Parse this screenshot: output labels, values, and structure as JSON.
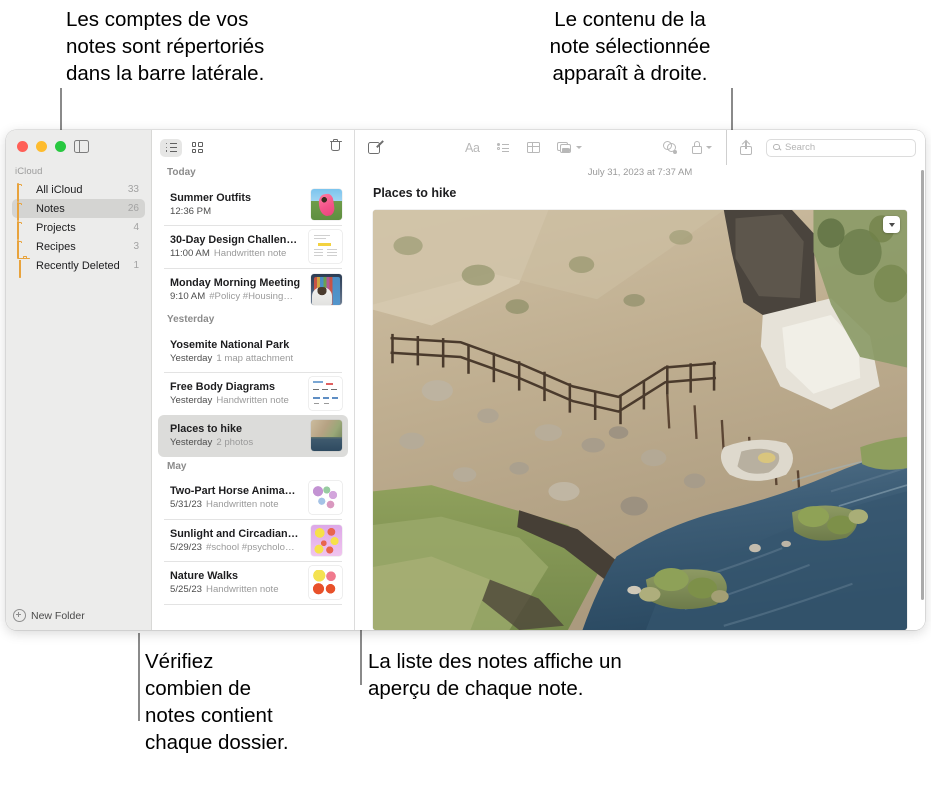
{
  "callouts": {
    "top_left": "Les comptes de vos\nnotes sont répertoriés\ndans la barre latérale.",
    "top_right": "Le contenu de la\nnote sélectionnée\napparaît à droite.",
    "bottom_left": "Vérifiez\ncombien de\nnotes contient\nchaque dossier.",
    "bottom_right": "La liste des notes affiche un\naperçu de chaque note."
  },
  "sidebar": {
    "section_label": "iCloud",
    "items": [
      {
        "label": "All iCloud",
        "count": "33",
        "icon": "folder-icon",
        "selected": false
      },
      {
        "label": "Notes",
        "count": "26",
        "icon": "folder-icon",
        "selected": true
      },
      {
        "label": "Projects",
        "count": "4",
        "icon": "folder-icon",
        "selected": false
      },
      {
        "label": "Recipes",
        "count": "3",
        "icon": "folder-icon",
        "selected": false
      },
      {
        "label": "Recently Deleted",
        "count": "1",
        "icon": "trash-icon",
        "selected": false
      }
    ],
    "new_folder_label": "New Folder"
  },
  "notes_list": {
    "view_list_icon": "list-view-icon",
    "view_grid_icon": "grid-view-icon",
    "delete_icon": "trash-icon",
    "groups": [
      {
        "header": "Today",
        "notes": [
          {
            "title": "Summer Outfits",
            "date": "12:36 PM",
            "subtitle": "",
            "thumb": "th-summer",
            "framed": false,
            "selected": false
          },
          {
            "title": "30-Day Design Challen…",
            "date": "11:00 AM",
            "subtitle": "Handwritten note",
            "thumb": "th-doc",
            "framed": true,
            "selected": false
          },
          {
            "title": "Monday Morning Meeting",
            "date": "9:10 AM",
            "subtitle": "#Policy #Housing…",
            "thumb": "th-meet",
            "framed": false,
            "selected": false
          }
        ]
      },
      {
        "header": "Yesterday",
        "notes": [
          {
            "title": "Yosemite National Park",
            "date": "Yesterday",
            "subtitle": "1 map attachment",
            "thumb": "",
            "framed": false,
            "selected": false
          },
          {
            "title": "Free Body Diagrams",
            "date": "Yesterday",
            "subtitle": "Handwritten note",
            "thumb": "th-fbd",
            "framed": true,
            "selected": false
          },
          {
            "title": "Places to hike",
            "date": "Yesterday",
            "subtitle": "2 photos",
            "thumb": "th-hike",
            "framed": false,
            "selected": true
          }
        ]
      },
      {
        "header": "May",
        "notes": [
          {
            "title": "Two-Part Horse Anima…",
            "date": "5/31/23",
            "subtitle": "Handwritten note",
            "thumb": "th-horse",
            "framed": true,
            "selected": false
          },
          {
            "title": "Sunlight and Circadian…",
            "date": "5/29/23",
            "subtitle": "#school #psycholo…",
            "thumb": "th-sun",
            "framed": false,
            "selected": false
          },
          {
            "title": "Nature Walks",
            "date": "5/25/23",
            "subtitle": "Handwritten note",
            "thumb": "th-nature",
            "framed": true,
            "selected": false
          }
        ]
      }
    ]
  },
  "detail": {
    "compose_icon": "compose-note-icon",
    "format_icon_label": "Aa",
    "checklist_icon": "checklist-icon",
    "table_icon": "table-icon",
    "media_icon": "media-icon",
    "collaborate_icon": "collaborate-icon",
    "lock_icon": "lock-icon",
    "share_icon": "share-icon",
    "date": "July 31, 2023 at 7:37 AM",
    "title": "Places to hike",
    "photo_expand_icon": "chevron-down-icon"
  },
  "search": {
    "placeholder": "Search",
    "value": "",
    "icon": "search-icon"
  },
  "colors": {
    "folder_accent": "#e8a33d",
    "selection": "#d4d4d2",
    "sidebar_bg": "#ececeb"
  }
}
